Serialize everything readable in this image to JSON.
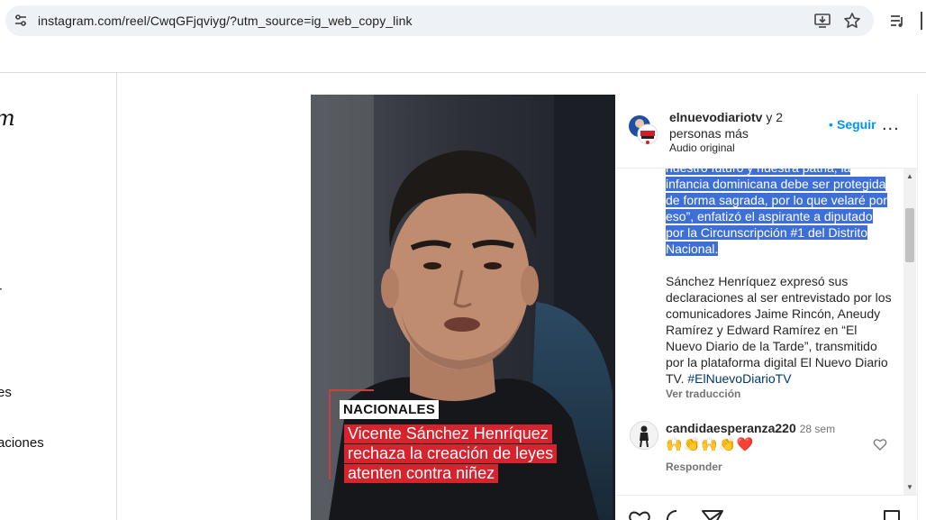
{
  "browser": {
    "url": "instagram.com/reel/CwqGFjqviyg/?utm_source=ig_web_copy_link"
  },
  "sidebar": {
    "logo_fragment": "m",
    "items": [
      {
        "label": "r"
      },
      {
        "label": "es"
      },
      {
        "label": "aciones"
      }
    ]
  },
  "video": {
    "category": "NACIONALES",
    "headline_lines": [
      "Vicente Sánchez Henríquez",
      "rechaza la creación de leyes",
      "atenten contra niñez"
    ]
  },
  "post": {
    "author": "elnuevodiariotv",
    "author_suffix": " y 2 personas más",
    "audio": "Audio original",
    "follow_label": "Seguir",
    "follow_dot": "•",
    "more_label": "...",
    "caption_highlighted": "nuestro futuro y nuestra patria, la infancia dominicana debe ser protegida de forma sagrada, por lo que velaré por eso”, enfatizó el aspirante a diputado por la Circunscripción #1 del Distrito Nacional.",
    "caption_body": "Sánchez Henríquez expresó sus declaraciones al ser entrevistado por los comunicadores Jaime Rincón, Aneudy Ramírez y Edward Ramírez en “El Nuevo Diario de la Tarde”, transmitido por la plataforma digital El Nuevo Diario TV. ",
    "hashtag": "#ElNuevoDiarioTV",
    "see_translation": "Ver traducción"
  },
  "comment": {
    "user": "candidaesperanza220",
    "time": "28 sem",
    "emojis": "🙌👏🙌👏❤️",
    "reply_label": "Responder"
  },
  "colors": {
    "accent_blue": "#0095f6",
    "selection": "#3d6fd6",
    "headline_red": "#d7232e"
  }
}
